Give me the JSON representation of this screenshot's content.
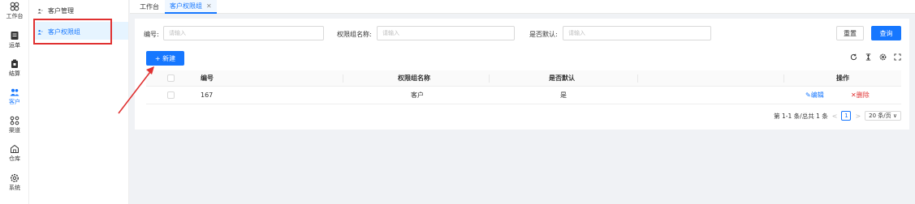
{
  "rail": {
    "items": [
      {
        "label": "工作台",
        "icon": "workbench-icon"
      },
      {
        "label": "运单",
        "icon": "waybill-icon"
      },
      {
        "label": "结算",
        "icon": "settlement-icon"
      },
      {
        "label": "客户",
        "icon": "customer-icon"
      },
      {
        "label": "渠道",
        "icon": "channel-icon"
      },
      {
        "label": "仓库",
        "icon": "warehouse-icon"
      },
      {
        "label": "系统",
        "icon": "system-icon"
      }
    ]
  },
  "submenu": {
    "items": [
      {
        "label": "客户管理"
      },
      {
        "label": "客户权限组"
      }
    ]
  },
  "tabs": {
    "items": [
      {
        "label": "工作台"
      },
      {
        "label": "客户权限组"
      }
    ]
  },
  "filters": {
    "code_label": "编号:",
    "code_placeholder": "请输入",
    "name_label": "权限组名称:",
    "name_placeholder": "请输入",
    "default_label": "是否默认:",
    "default_placeholder": "请输入",
    "reset_label": "重置",
    "search_label": "查询"
  },
  "toolbar": {
    "new_label": "+ 新建"
  },
  "table": {
    "headers": {
      "code": "编号",
      "name": "权限组名称",
      "is_default": "是否默认",
      "actions": "操作"
    },
    "rows": [
      {
        "code": "167",
        "name": "客户",
        "is_default": "是",
        "edit": "✎编辑",
        "delete": "✕删除"
      }
    ]
  },
  "pagination": {
    "summary": "第 1-1 条/总共 1 条",
    "prev": "<",
    "current": "1",
    "next": ">",
    "page_size": "20 条/页 ∨"
  },
  "colors": {
    "accent": "#1677ff",
    "danger": "#e03131",
    "highlight_box": "#e03131"
  }
}
